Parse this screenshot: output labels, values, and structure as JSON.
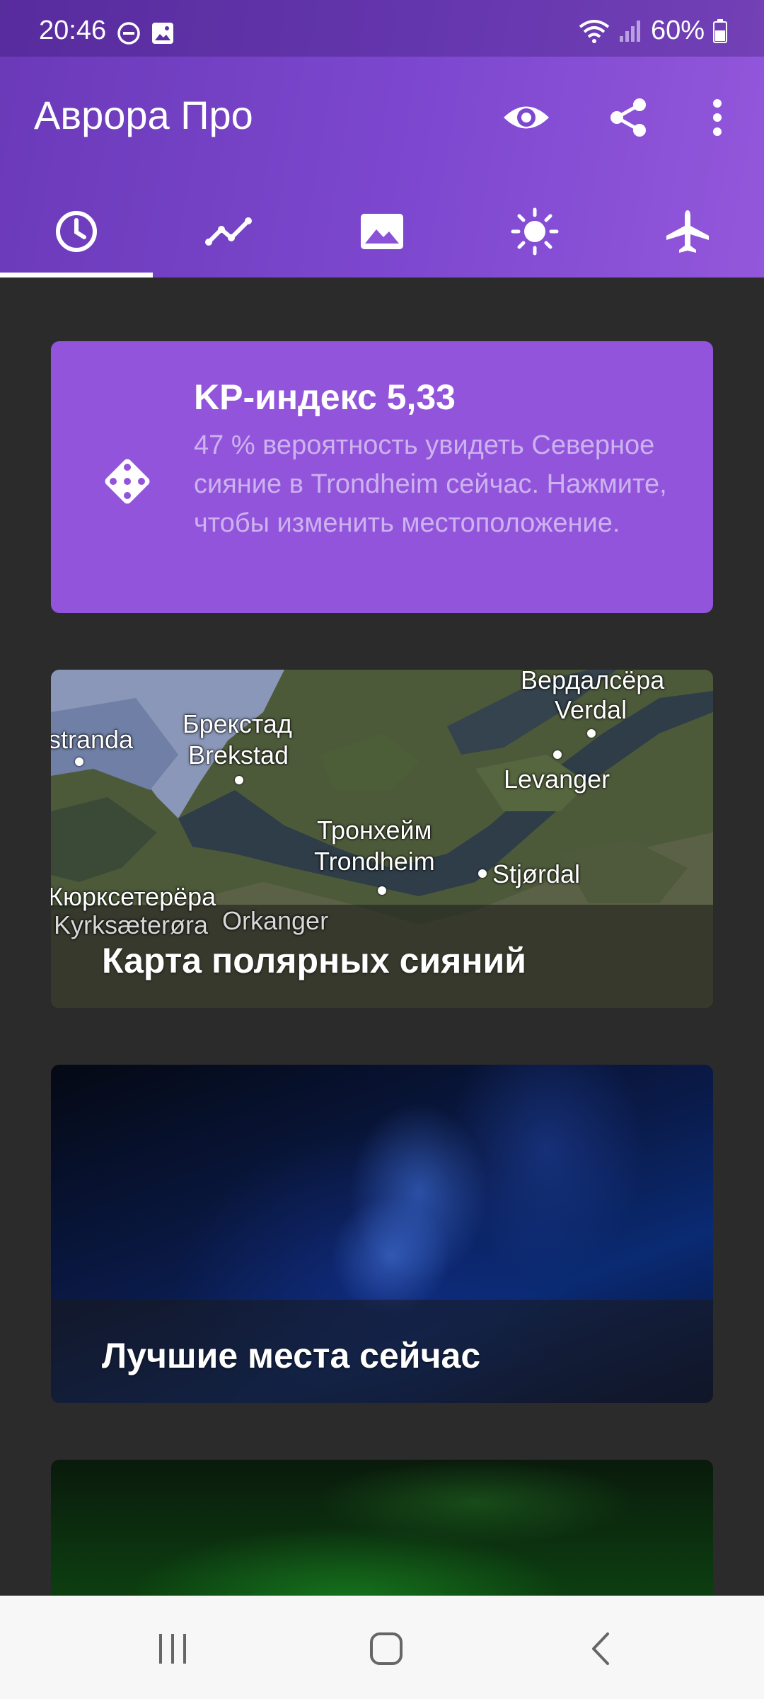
{
  "status_bar": {
    "time": "20:46",
    "battery": "60%",
    "left_icons": [
      "do-not-disturb-icon",
      "image-icon"
    ],
    "right_icons": [
      "wifi-icon",
      "signal-icon",
      "battery-icon"
    ]
  },
  "app_bar": {
    "title": "Аврора Про",
    "actions": [
      "eye-icon",
      "share-icon",
      "more-vert-icon"
    ]
  },
  "tabs": [
    {
      "icon": "clock-icon",
      "selected": true
    },
    {
      "icon": "trend-icon",
      "selected": false
    },
    {
      "icon": "image-icon",
      "selected": false
    },
    {
      "icon": "sun-icon",
      "selected": false
    },
    {
      "icon": "airplane-icon",
      "selected": false
    }
  ],
  "kp_card": {
    "title": "KP-индекс 5,33",
    "description": "47 % вероятность увидеть Северное сияние в Trondheim сейчас. Нажмите, чтобы изменить местоположение.",
    "icon": "dice-icon"
  },
  "map_card": {
    "title": "Карта полярных сияний",
    "labels": {
      "verdalsora": "Вердалсёра",
      "verdal": "Verdal",
      "stranda": "stranda",
      "brekstad_ru": "Брекстад",
      "brekstad": "Brekstad",
      "levanger": "Levanger",
      "trondheim_ru": "Тронхейм",
      "trondheim": "Trondheim",
      "stjordal": "Stjørdal",
      "kyrksaetera_ru": "Кюрксетерёра",
      "kyrksaetera": "Kyrksæterøra",
      "orkanger": "Orkanger"
    }
  },
  "best_places_card": {
    "title": "Лучшие места сейчас"
  },
  "nav_bar": {
    "buttons": [
      "recents-icon",
      "home-icon",
      "back-icon"
    ]
  },
  "colors": {
    "header": "#7d48cf",
    "kp_card": "#9254db",
    "kp_desc": "#cdb2f0",
    "background": "#2b2b2b",
    "nav_bar": "#f7f7f7"
  }
}
